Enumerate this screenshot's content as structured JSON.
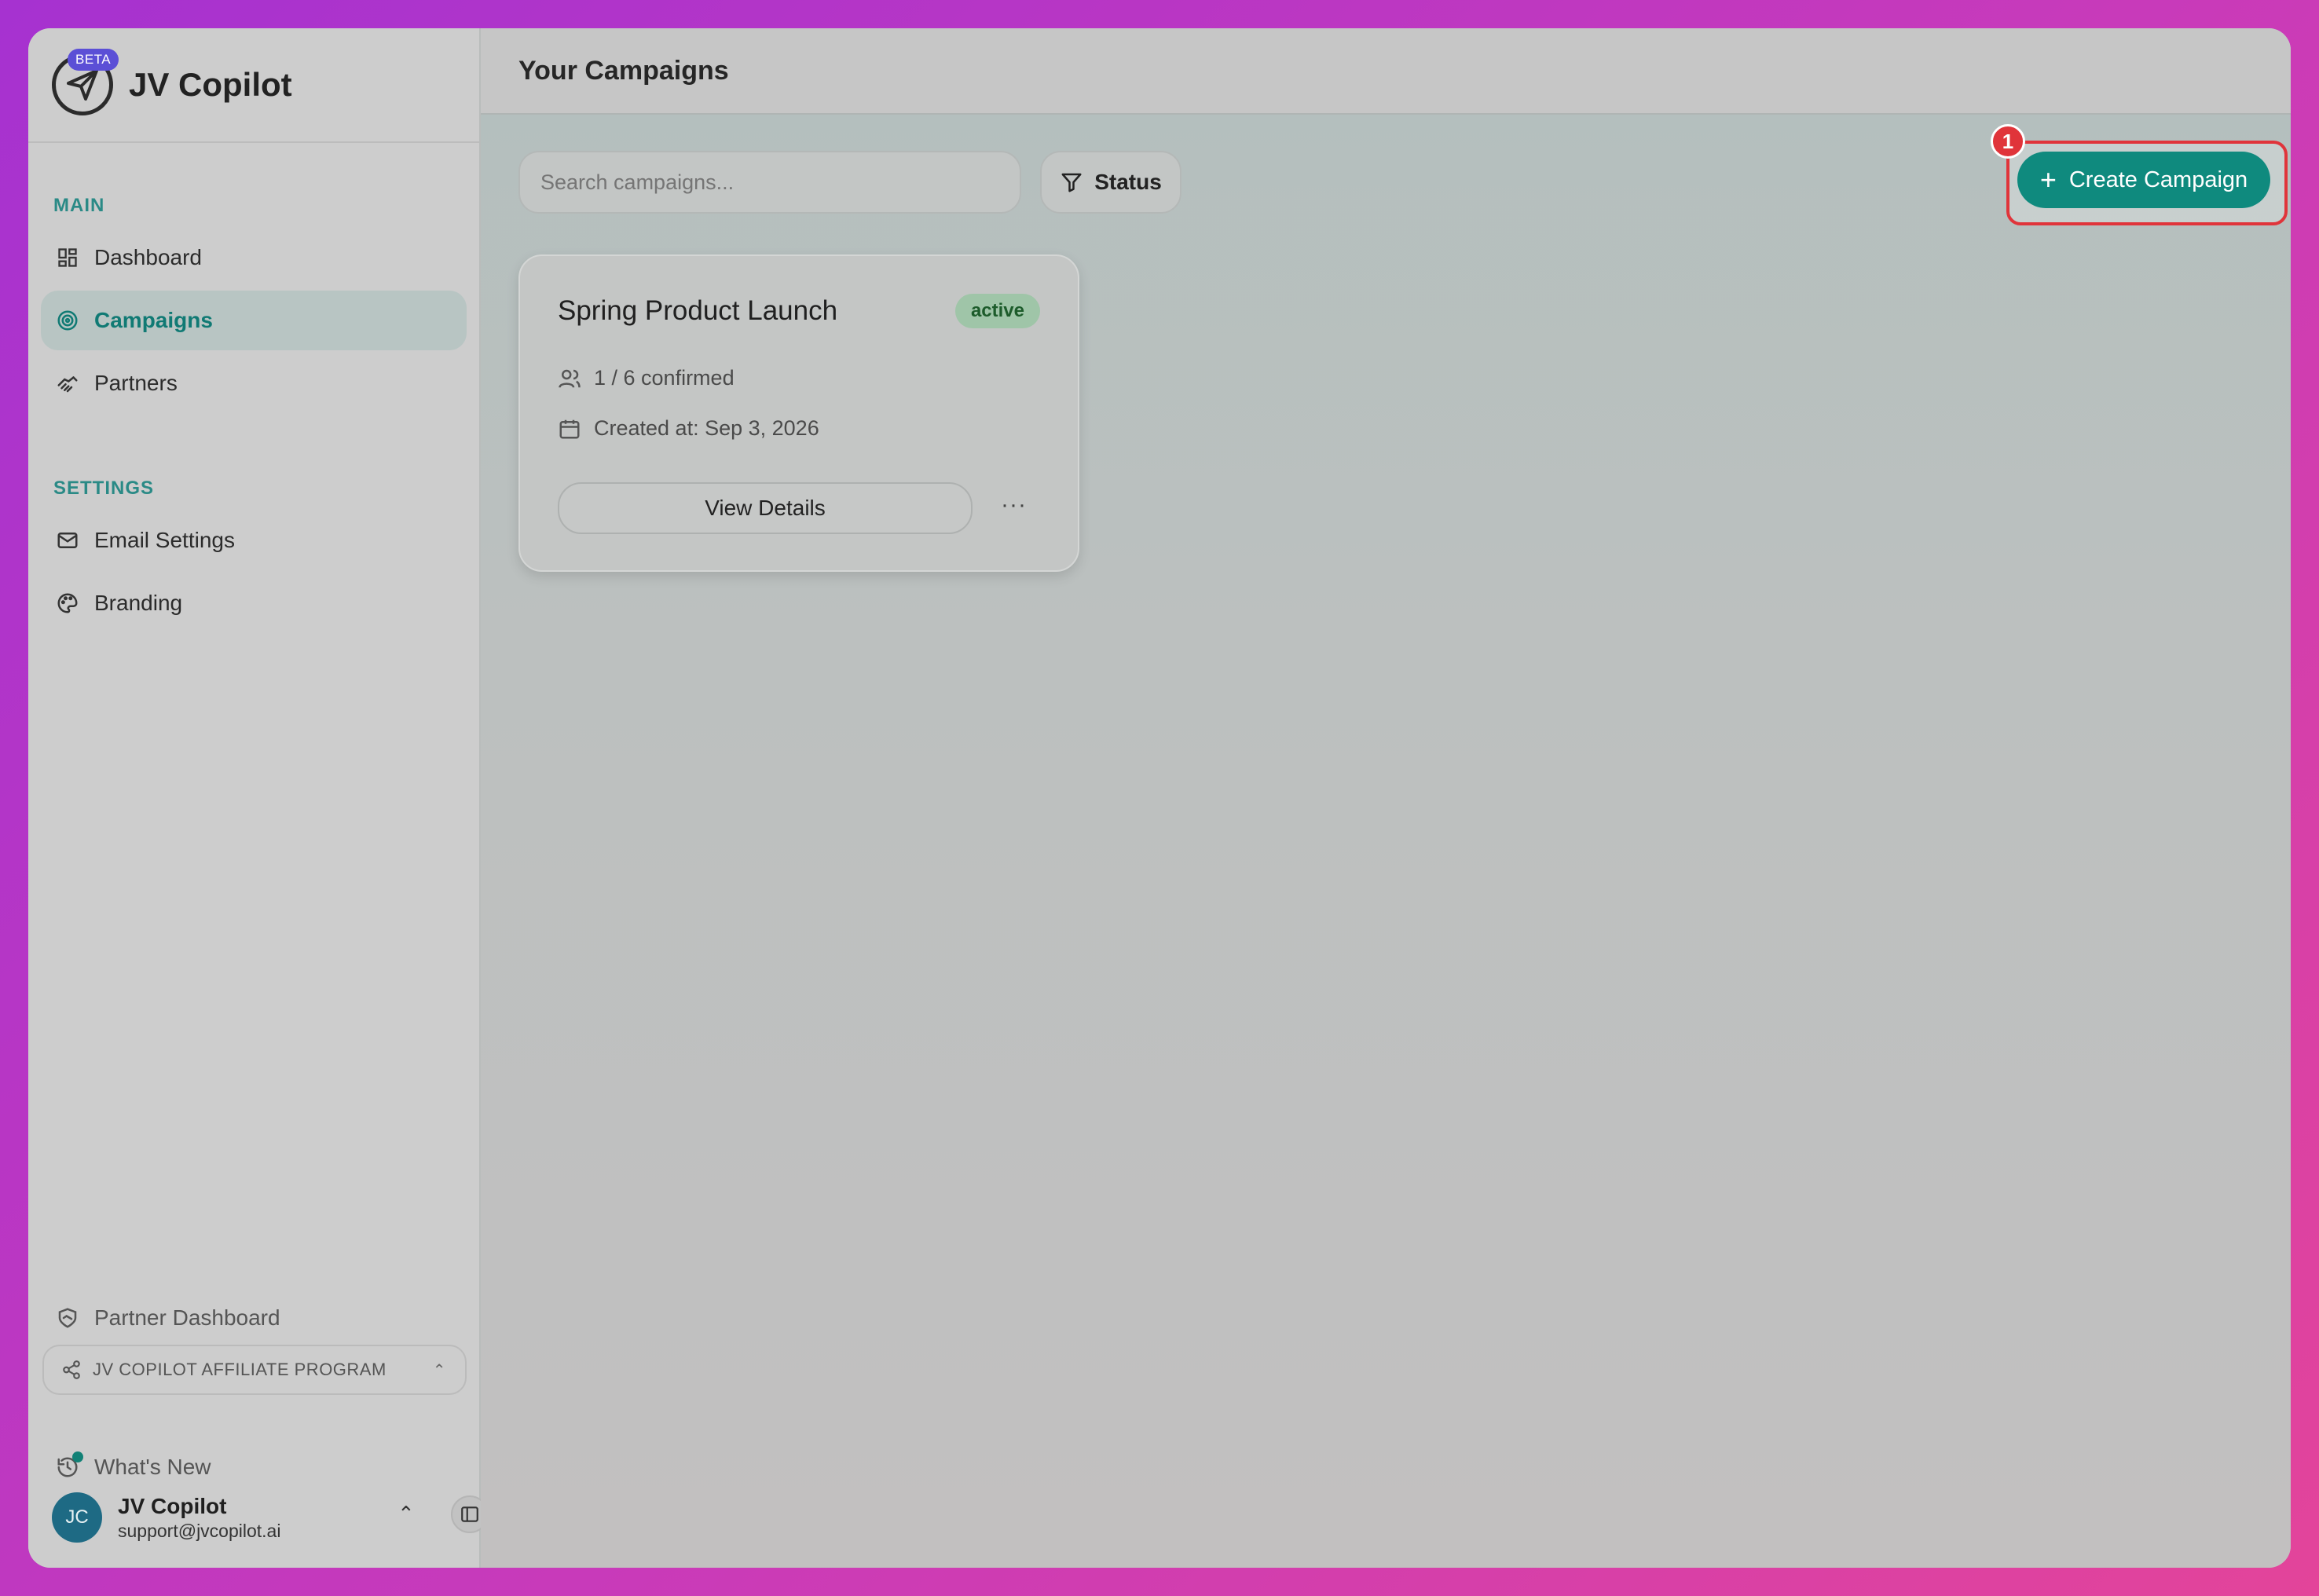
{
  "brand": {
    "name": "JV Copilot",
    "badge": "BETA"
  },
  "sidebar": {
    "main_label": "MAIN",
    "settings_label": "SETTINGS",
    "items": [
      {
        "label": "Dashboard",
        "icon": "dashboard-icon"
      },
      {
        "label": "Campaigns",
        "icon": "target-icon",
        "active": true
      },
      {
        "label": "Partners",
        "icon": "handshake-icon"
      },
      {
        "label": "Email Settings",
        "icon": "mail-icon"
      },
      {
        "label": "Branding",
        "icon": "palette-icon"
      }
    ],
    "partner_dashboard": "Partner Dashboard",
    "affiliate_program": "JV COPILOT AFFILIATE PROGRAM",
    "whats_new": "What's New",
    "user": {
      "initials": "JC",
      "name": "JV Copilot",
      "email": "support@jvcopilot.ai"
    }
  },
  "header": {
    "title": "Your Campaigns"
  },
  "toolbar": {
    "search_placeholder": "Search campaigns...",
    "status_label": "Status",
    "create_label": "Create Campaign",
    "marker": "1"
  },
  "campaigns": [
    {
      "title": "Spring Product Launch",
      "status": "active",
      "confirmed": "1 / 6 confirmed",
      "created": "Created at: Sep 3, 2026",
      "view_label": "View Details",
      "more_label": "···"
    }
  ],
  "colors": {
    "accent": "#0f8a7e",
    "highlight": "#e0343a",
    "badge_bg": "#9fc5a8"
  }
}
